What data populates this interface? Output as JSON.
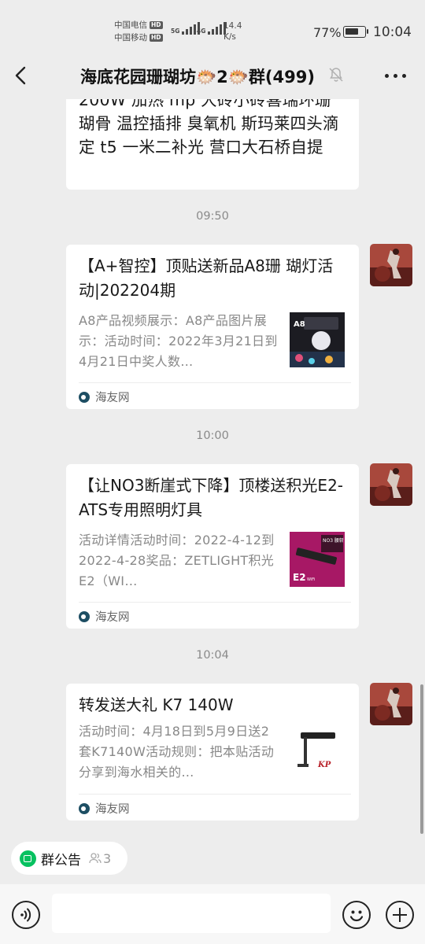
{
  "status_bar": {
    "carrier1": "中国电信",
    "carrier2": "中国移动",
    "hd": "HD",
    "sig1_label": "5G",
    "sig2_label": "4G",
    "net_speed_value": "14.4",
    "net_speed_unit": "K/s",
    "battery_percent": "77%",
    "battery_level": 0.77,
    "time": "10:04"
  },
  "navbar": {
    "title": "海底花园珊瑚坊🐡2🐡群(499)",
    "back_icon": "chevron-left-icon",
    "mute_icon": "bell-off-icon",
    "more_icon": "more-horizontal-icon"
  },
  "chat": {
    "partial_message": "200W 加热  mp 大砖小砖喜瑞环珊瑚骨 温控插排  臭氧机  斯玛莱四头滴定 t5 一米二补光  营口大石桥自提",
    "messages": [
      {
        "time": "09:50",
        "title": "【A+智控】顶贴送新品A8珊 瑚灯活动|202204期",
        "desc": "A8产品视频展示：A8产品图片展示：活动时间：2022年3月21日到4月21日中奖人数…",
        "thumb_text": "A8",
        "source": "海友网"
      },
      {
        "time": "10:00",
        "title": "【让NO3断崖式下降】顶楼送积光E2-ATS专用照明灯具",
        "desc": "活动详情活动时间：2022-4-12到2022-4-28奖品：ZETLIGHT积光E2（WI…",
        "thumb_text": "E2",
        "thumb_sub": "NO3 腰斩 50不要用",
        "thumb_wifi": "WiFi",
        "source": "海友网"
      },
      {
        "time": "10:04",
        "title": "转发送大礼 K7 140W",
        "desc": "活动时间：4月18日到5月9日送2套K7140W活动规则：把本贴活动分享到海水相关的…",
        "thumb_text": "KP",
        "source": "海友网"
      }
    ]
  },
  "bottom": {
    "notice_label": "群公告",
    "member_count": "3",
    "input_placeholder": "",
    "voice_icon": "voice-icon",
    "emoji_icon": "emoji-icon",
    "plus_icon": "plus-icon"
  },
  "colors": {
    "background": "#ededed",
    "bubble": "#ffffff",
    "accent_green": "#07c160",
    "muted_text": "#888888",
    "source_icon": "#1d4e63"
  }
}
